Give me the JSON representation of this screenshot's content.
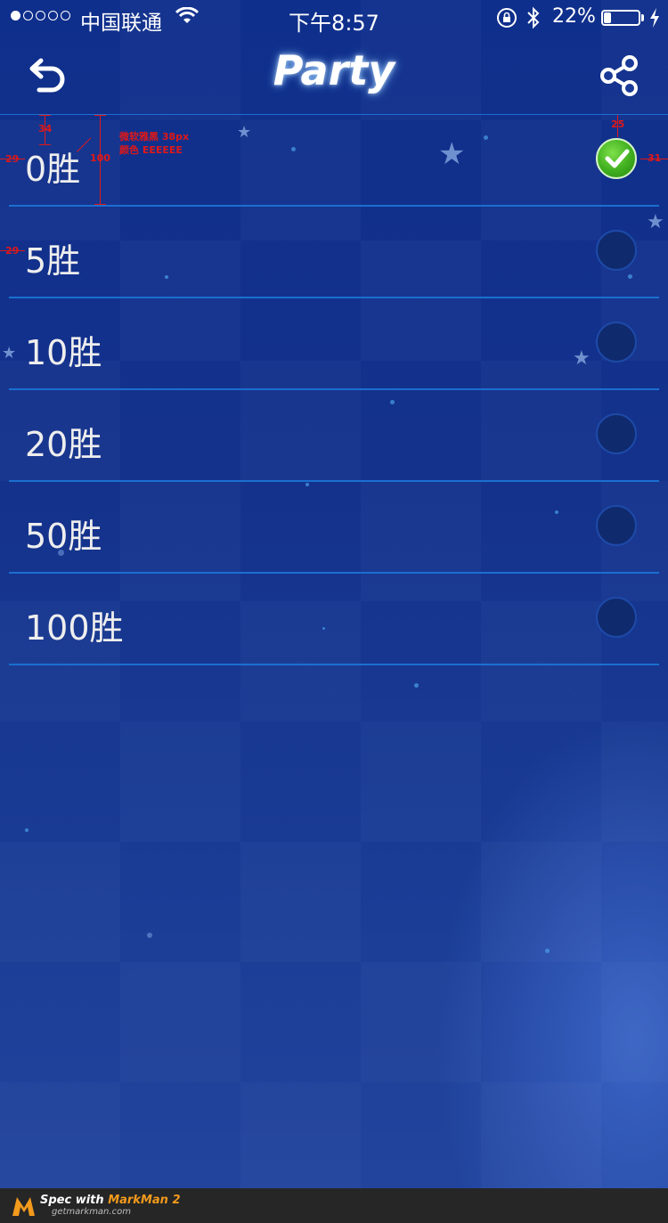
{
  "status_bar": {
    "carrier": "中国联通",
    "time": "下午8:57",
    "battery_percent": "22%",
    "battery_level": 0.22,
    "signal_bars_on": 1,
    "signal_bars_total": 5
  },
  "header": {
    "title": "Party",
    "back_icon": "back-arrow-icon",
    "share_icon": "share-icon"
  },
  "options": [
    {
      "label": "0胜",
      "selected": true
    },
    {
      "label": "5胜",
      "selected": false
    },
    {
      "label": "10胜",
      "selected": false
    },
    {
      "label": "20胜",
      "selected": false
    },
    {
      "label": "50胜",
      "selected": false
    },
    {
      "label": "100胜",
      "selected": false
    }
  ],
  "annotations": {
    "top_gap": "34",
    "left_gap": "29",
    "left_gap_row2": "29",
    "row_height": "100",
    "font_note": "微软雅黑 38px",
    "color_note": "颜色 EEEEEE",
    "check_top": "25",
    "check_right": "31"
  },
  "colors": {
    "accent_line": "#1a6fd0",
    "label_text": "#eeeeee",
    "check_green": "#3fae1e",
    "spec_red": "#e01818"
  },
  "footer": {
    "brand_prefix": "Spec with ",
    "brand_name": "MarkMan 2",
    "url": "getmarkman.com"
  }
}
